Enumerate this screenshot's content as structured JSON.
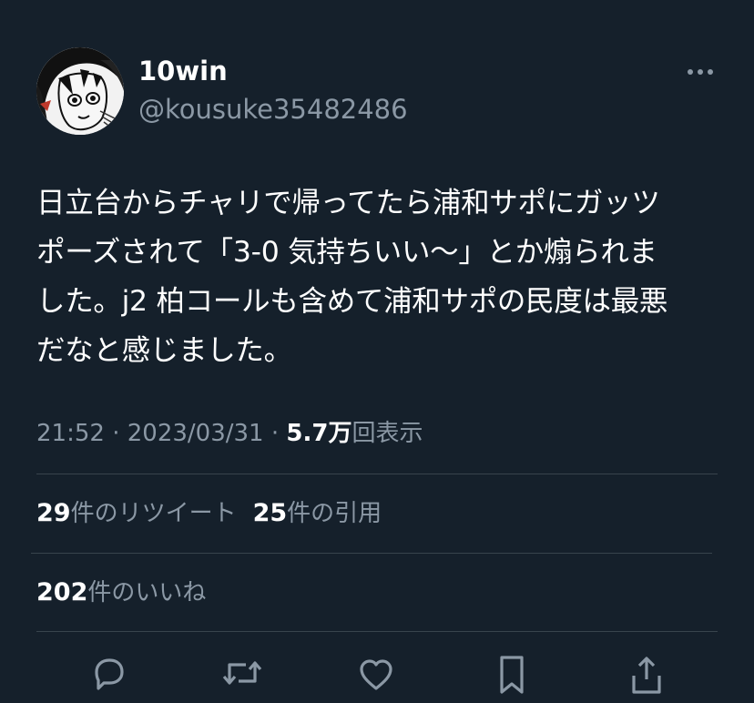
{
  "user": {
    "display_name": "10win",
    "handle": "@kousuke35482486"
  },
  "tweet": {
    "text_lines": [
      "日立台からチャリで帰ってたら浦和サポにガッツ",
      "ポーズされて「3-0 気持ちいい〜」とか煽られま",
      "した。j2 柏コールも含めて浦和サポの民度は最悪",
      "だなと感じました。"
    ],
    "time": "21:52",
    "separator": "·",
    "date": "2023/03/31",
    "views_count": "5.7万",
    "views_label": "回表示"
  },
  "stats": {
    "retweets_count": "29",
    "retweets_label": "件のリツイート",
    "quotes_count": "25",
    "quotes_label": "件の引用",
    "likes_count": "202",
    "likes_label": "件のいいね"
  },
  "icons": {
    "more": "more-icon",
    "reply": "reply-icon",
    "retweet": "retweet-icon",
    "like": "like-icon",
    "bookmark": "bookmark-icon",
    "share": "share-icon"
  },
  "colors": {
    "background": "#15202b",
    "text_primary": "#ffffff",
    "text_secondary": "#8b98a5",
    "divider": "#38444d"
  }
}
